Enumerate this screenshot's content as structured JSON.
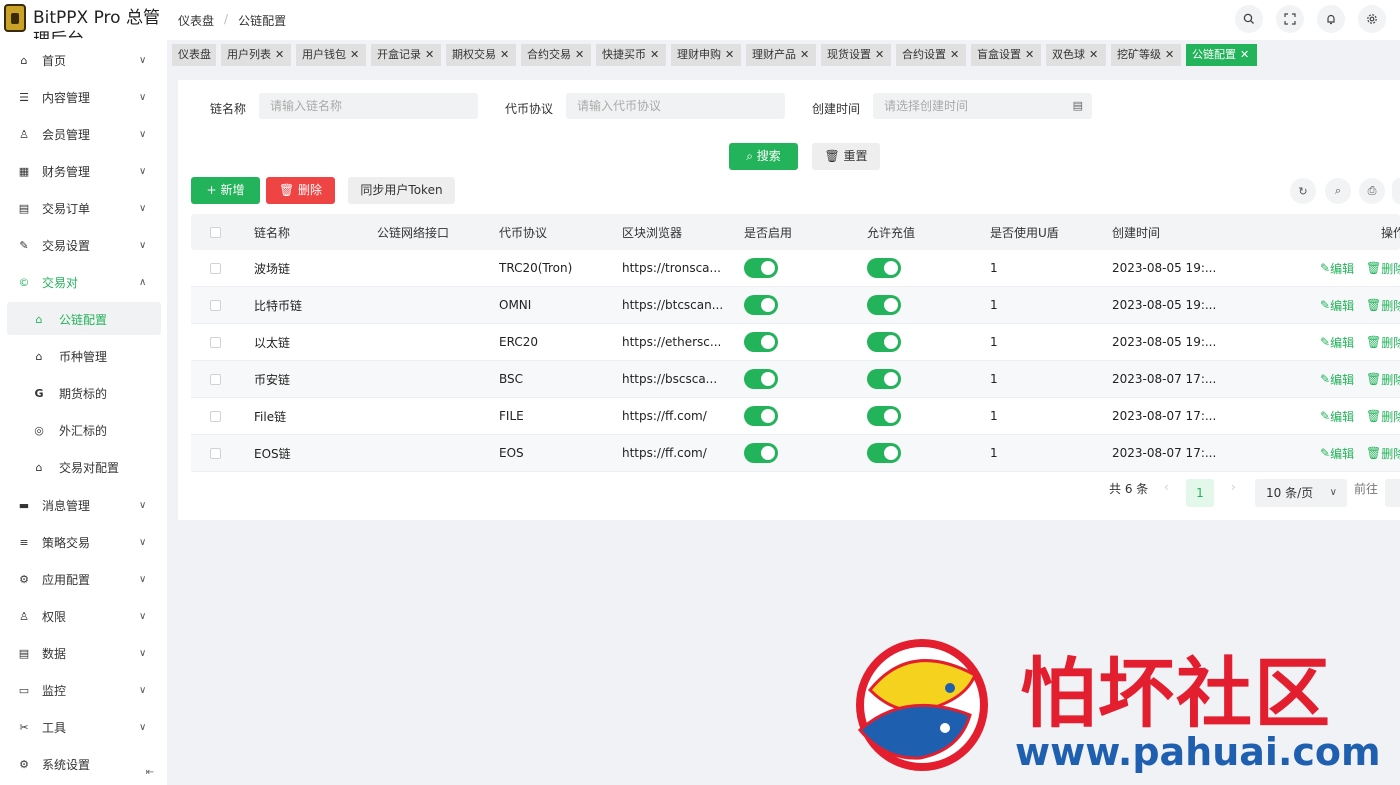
{
  "app": {
    "title": "BitPPX Pro 总管理后台"
  },
  "breadcrumb": [
    "仪表盘",
    "公链配置"
  ],
  "sidebar": {
    "items": [
      {
        "label": "首页",
        "icon": "home-icon",
        "glyph": "⌂"
      },
      {
        "label": "内容管理",
        "icon": "list-icon",
        "glyph": "☰"
      },
      {
        "label": "会员管理",
        "icon": "user-icon",
        "glyph": "♙"
      },
      {
        "label": "财务管理",
        "icon": "table-icon",
        "glyph": "▦"
      },
      {
        "label": "交易订单",
        "icon": "order-icon",
        "glyph": "▤"
      },
      {
        "label": "交易设置",
        "icon": "tool-icon",
        "glyph": "✎"
      },
      {
        "label": "交易对",
        "icon": "copyright-icon",
        "glyph": "©"
      }
    ],
    "sub_items": [
      {
        "label": "公链配置",
        "icon": "home-icon",
        "glyph": "⌂"
      },
      {
        "label": "币种管理",
        "icon": "home-icon",
        "glyph": "⌂"
      },
      {
        "label": "期货标的",
        "icon": "g-icon",
        "glyph": "G"
      },
      {
        "label": "外汇标的",
        "icon": "coin-icon",
        "glyph": "◎"
      },
      {
        "label": "交易对配置",
        "icon": "home-icon",
        "glyph": "⌂"
      }
    ],
    "items_after": [
      {
        "label": "消息管理",
        "icon": "message-icon",
        "glyph": "▬"
      },
      {
        "label": "策略交易",
        "icon": "menu-icon",
        "glyph": "≡"
      },
      {
        "label": "应用配置",
        "icon": "config-icon",
        "glyph": "⚙"
      },
      {
        "label": "权限",
        "icon": "permission-icon",
        "glyph": "♙"
      },
      {
        "label": "数据",
        "icon": "data-icon",
        "glyph": "▤"
      },
      {
        "label": "监控",
        "icon": "monitor-icon",
        "glyph": "▭"
      },
      {
        "label": "工具",
        "icon": "scissors-icon",
        "glyph": "✂"
      },
      {
        "label": "系统设置",
        "icon": "gear-icon",
        "glyph": "⚙"
      }
    ]
  },
  "tabs": [
    "仪表盘",
    "用户列表",
    "用户钱包",
    "开盒记录",
    "期权交易",
    "合约交易",
    "快捷买币",
    "理财申购",
    "理财产品",
    "现货设置",
    "合约设置",
    "盲盒设置",
    "双色球",
    "挖矿等级",
    "公链配置"
  ],
  "filters": {
    "chain_name_label": "链名称",
    "chain_name_placeholder": "请输入链名称",
    "protocol_label": "代币协议",
    "protocol_placeholder": "请输入代币协议",
    "created_label": "创建时间",
    "created_placeholder": "请选择创建时间"
  },
  "buttons": {
    "search": "搜索",
    "reset": "重置",
    "add": "新增",
    "delete": "删除",
    "sync": "同步用户Token"
  },
  "table": {
    "columns": [
      "链名称",
      "公链网络接口",
      "代币协议",
      "区块浏览器",
      "是否启用",
      "允许充值",
      "是否使用U盾",
      "创建时间",
      "操作"
    ],
    "rows": [
      {
        "name": "波场链",
        "api": "",
        "protocol": "TRC20(Tron)",
        "explorer": "https://tronsca...",
        "enabled": true,
        "recharge": true,
        "ushield": "1",
        "created": "2023-08-05 19:..."
      },
      {
        "name": "比特币链",
        "api": "",
        "protocol": "OMNI",
        "explorer": "https://btcscan...",
        "enabled": true,
        "recharge": true,
        "ushield": "1",
        "created": "2023-08-05 19:..."
      },
      {
        "name": "以太链",
        "api": "",
        "protocol": "ERC20",
        "explorer": "https://ethersc...",
        "enabled": true,
        "recharge": true,
        "ushield": "1",
        "created": "2023-08-05 19:..."
      },
      {
        "name": "币安链",
        "api": "",
        "protocol": "BSC",
        "explorer": "https://bscsca...",
        "enabled": true,
        "recharge": true,
        "ushield": "1",
        "created": "2023-08-07 17:..."
      },
      {
        "name": "File链",
        "api": "",
        "protocol": "FILE",
        "explorer": "https://ff.com/",
        "enabled": true,
        "recharge": true,
        "ushield": "1",
        "created": "2023-08-07 17:..."
      },
      {
        "name": "EOS链",
        "api": "",
        "protocol": "EOS",
        "explorer": "https://ff.com/",
        "enabled": true,
        "recharge": true,
        "ushield": "1",
        "created": "2023-08-07 17:..."
      }
    ],
    "edit_label": "编辑",
    "delete_label": "删除"
  },
  "pagination": {
    "total": "共 6 条",
    "page": "1",
    "size": "10 条/页",
    "goto": "前往"
  },
  "watermark": {
    "title": "怕坏社区",
    "url": "www.pahuai.com"
  },
  "colors": {
    "accent": "#23b35a",
    "danger": "#ee4444"
  }
}
